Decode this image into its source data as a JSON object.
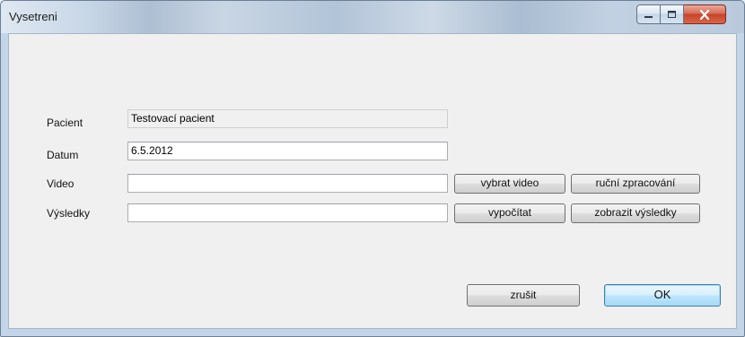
{
  "window": {
    "title": "Vysetreni",
    "controls": {
      "minimize_icon": "minimize-icon",
      "maximize_icon": "maximize-icon",
      "close_icon": "close-icon"
    }
  },
  "form": {
    "pacient": {
      "label": "Pacient",
      "value": "Testovací pacient"
    },
    "datum": {
      "label": "Datum",
      "value": "6.5.2012"
    },
    "video": {
      "label": "Video",
      "value": ""
    },
    "vysledky": {
      "label": "Výsledky",
      "value": ""
    }
  },
  "buttons": {
    "vybrat_video": "vybrat video",
    "rucni_zpracovani": "ruční zpracování",
    "vypocitat": "vypočítat",
    "zobrazit_vysledky": "zobrazit výsledky",
    "zrusit": "zrušit",
    "ok": "OK"
  },
  "colors": {
    "close_button": "#c8432a",
    "default_button_border": "#3c7fb1"
  }
}
